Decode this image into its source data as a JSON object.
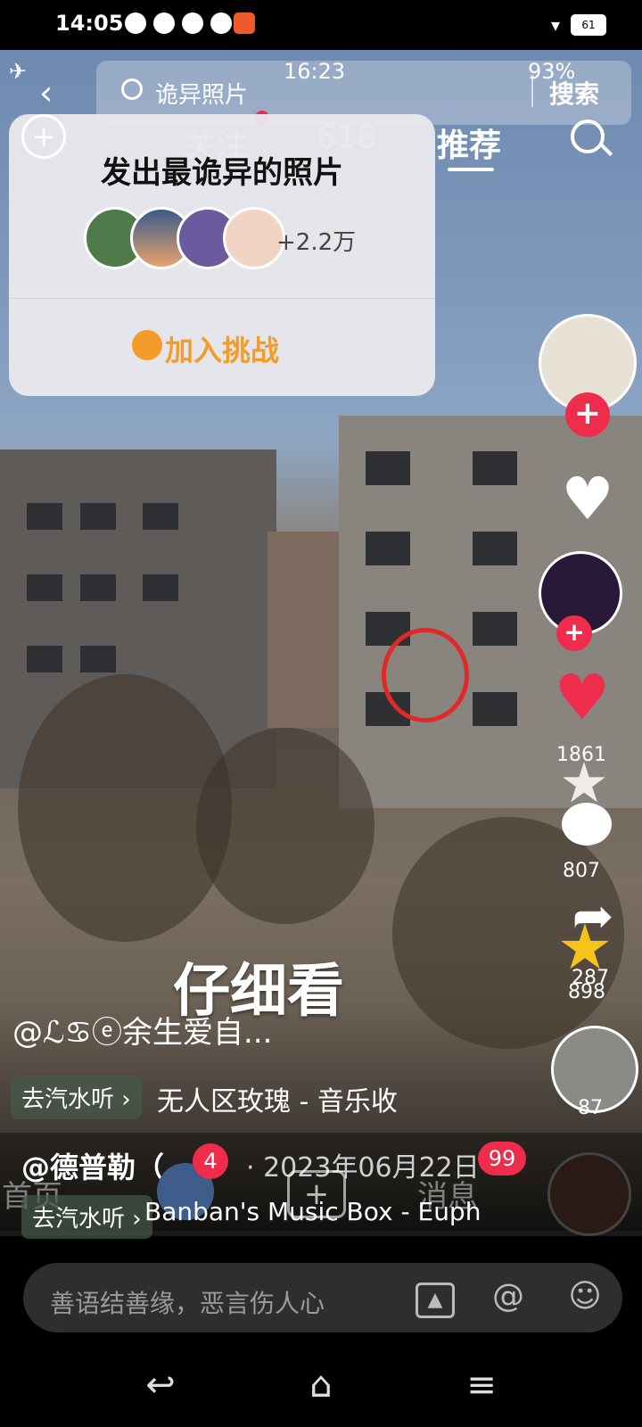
{
  "status_bar": {
    "time": "14:05",
    "battery": "61"
  },
  "inner_status": {
    "time": "16:23",
    "battery": "93%"
  },
  "search": {
    "placeholder": "诡异照片",
    "button": "搜索"
  },
  "top_nav": {
    "items": [
      "关注",
      "618",
      "推荐"
    ],
    "active": "推荐"
  },
  "challenge": {
    "title": "发出最诡异的照片",
    "participants": "+2.2万",
    "join_label": "加入挑战"
  },
  "right_rail": {
    "like_count": "1861",
    "comment_count": "807",
    "share_count": "287",
    "fav_count": "898",
    "share2_count": "87"
  },
  "video": {
    "caption": "仔细看",
    "author": "@ℒ♋ⓔ余生爱自...",
    "music_tag": "去汽水听 ›",
    "music_title": "无人区玫瑰 - 音乐收"
  },
  "overlay": {
    "author": "@德普勒（…",
    "date": "· 2023年06月22日",
    "music_tag": "去汽水听 ›",
    "music_title": "Banban's Music Box - Eupho",
    "home_label": "首页",
    "messages_label": "消息",
    "friends_badge": "4",
    "messages_badge": "99"
  },
  "comment_input": {
    "placeholder": "善语结善缘，恶言伤人心"
  },
  "colors": {
    "accent_orange": "#f39c2a",
    "badge_red": "#ee2c4c"
  }
}
